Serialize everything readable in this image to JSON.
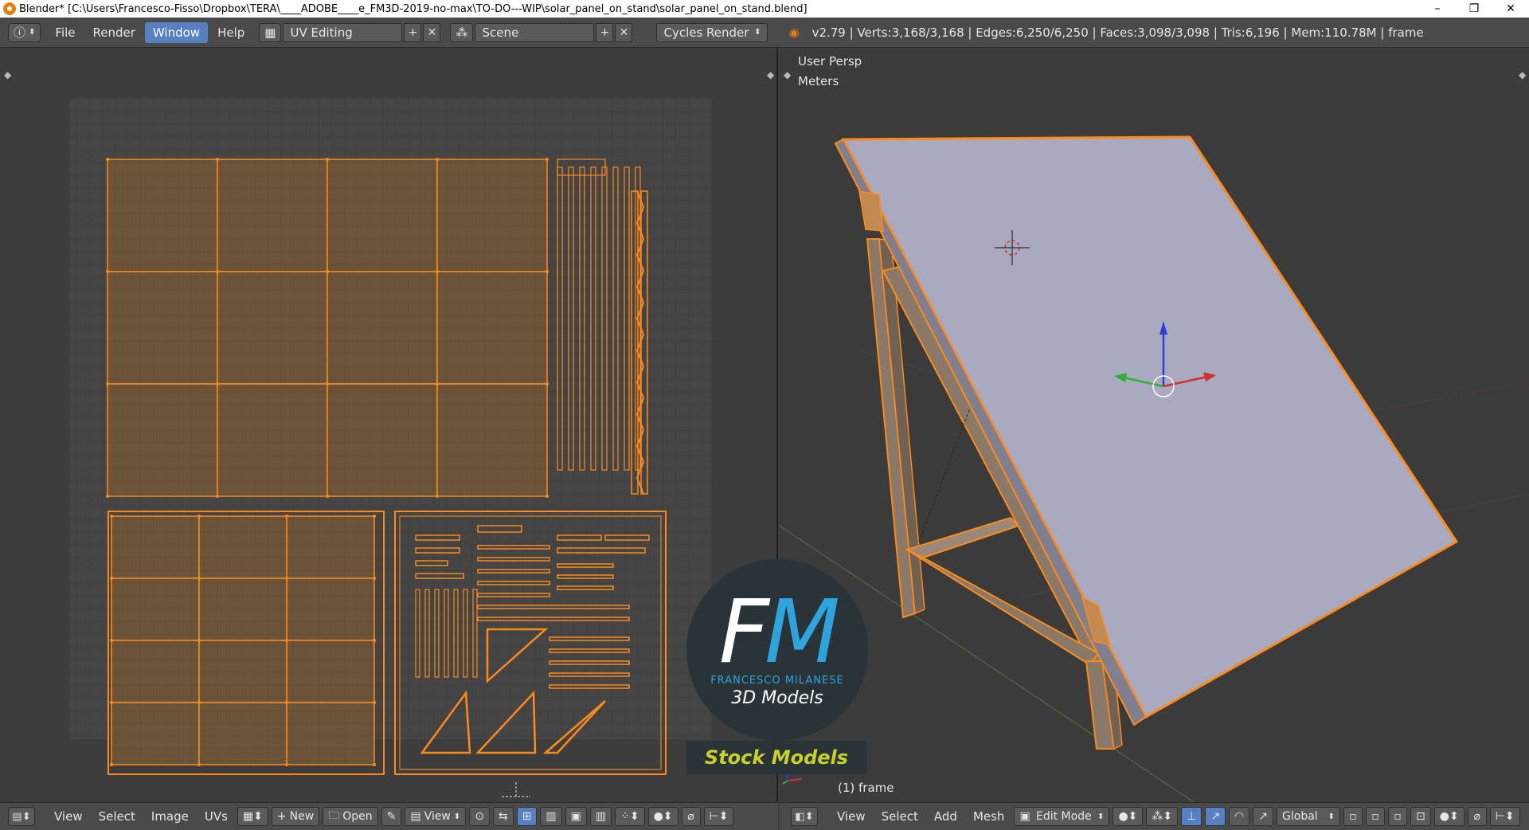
{
  "window": {
    "title": "Blender* [C:\\Users\\Francesco-Fisso\\Dropbox\\TERA\\____ADOBE____e_FM3D-2019-no-max\\TO-DO---WIP\\solar_panel_on_stand\\solar_panel_on_stand.blend]",
    "minimize": "–",
    "restore": "❐",
    "close": "✕"
  },
  "info_header": {
    "info_icon": "ⓘ",
    "menus": [
      "File",
      "Render",
      "Window",
      "Help"
    ],
    "layout": "UV Editing",
    "scene": "Scene",
    "engine": "Cycles Render",
    "stats": "v2.79 | Verts:3,168/3,168 | Edges:6,250/6,250 | Faces:3,098/3,098 | Tris:6,196 | Mem:110.78M | frame"
  },
  "viewport": {
    "persp": "User Persp",
    "units": "Meters",
    "object": "(1) frame"
  },
  "uv_footer": {
    "menus": [
      "View",
      "Select",
      "Image",
      "UVs"
    ],
    "new_label": "New",
    "open_label": "Open",
    "view_label": "View"
  },
  "view3d_footer": {
    "menus": [
      "View",
      "Select",
      "Add",
      "Mesh"
    ],
    "mode": "Edit Mode",
    "orientation": "Global"
  },
  "watermark": {
    "letter_f": "F",
    "letter_m": "M",
    "name": "FRANCESCO MILANESE",
    "tagline": "3D Models",
    "banner": "Stock Models"
  },
  "colors": {
    "accent": "#5680c2",
    "uv_orange": "#ff8a1a",
    "panel_gray": "#a9a9c0"
  }
}
